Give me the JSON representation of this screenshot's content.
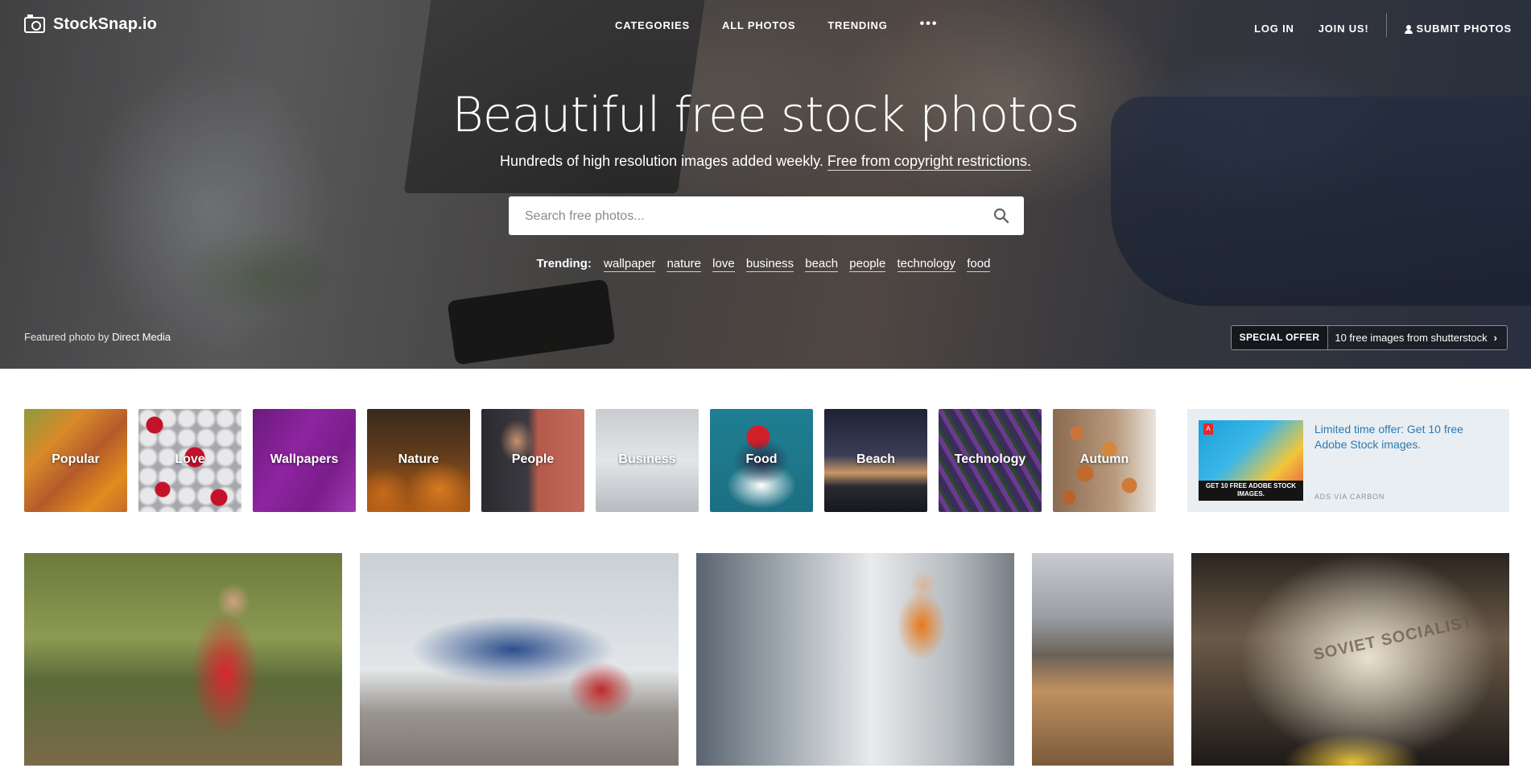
{
  "nav": {
    "logo_text": "StockSnap.io",
    "links": [
      "CATEGORIES",
      "ALL PHOTOS",
      "TRENDING"
    ],
    "more": "•••",
    "login": "LOG IN",
    "join": "JOIN US!",
    "submit": "SUBMIT PHOTOS"
  },
  "hero": {
    "headline": "Beautiful free stock photos",
    "subline_text": "Hundreds of high resolution images added weekly.",
    "subline_link": "Free from copyright restrictions.",
    "search_placeholder": "Search free photos...",
    "trending_label": "Trending:",
    "trending_tags": [
      "wallpaper",
      "nature",
      "love",
      "business",
      "beach",
      "people",
      "technology",
      "food"
    ],
    "featured_prefix": "Featured photo by",
    "featured_author": "Direct Media",
    "offer_badge": "SPECIAL OFFER",
    "offer_text": "10 free images from shutterstock"
  },
  "categories": [
    "Popular",
    "Love",
    "Wallpapers",
    "Nature",
    "People",
    "Business",
    "Food",
    "Beach",
    "Technology",
    "Autumn"
  ],
  "ad": {
    "image_caption": "GET 10 FREE ADOBE STOCK IMAGES.",
    "text": "Limited time offer: Get 10 free Adobe Stock images.",
    "via": "ADS VIA CARBON"
  },
  "photos": {
    "map_text": "SOVIET SOCIALIST"
  }
}
